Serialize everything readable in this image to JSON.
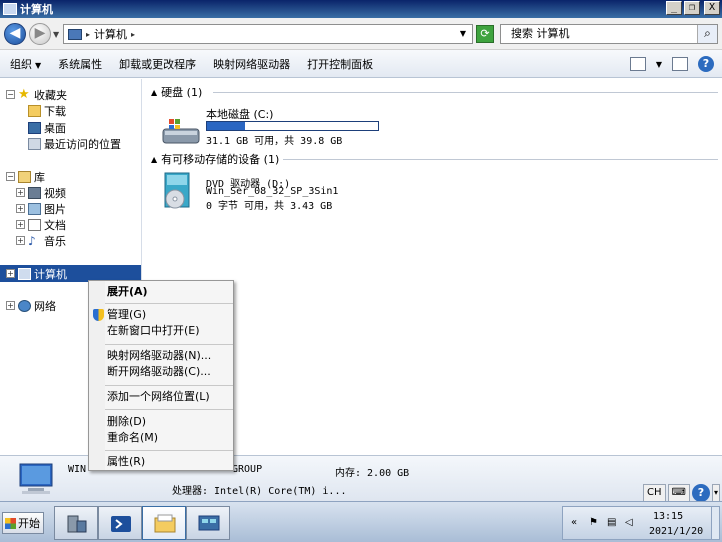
{
  "window": {
    "title": "计算机",
    "buttons": {
      "minimize": "_",
      "restore": "❐",
      "close": "X"
    }
  },
  "address": {
    "crumb": "计算机",
    "search_placeholder": "搜索 计算机"
  },
  "toolbar": {
    "items": [
      "组织",
      "系统属性",
      "卸载或更改程序",
      "映射网络驱动器",
      "打开控制面板"
    ],
    "help": "?"
  },
  "nav": {
    "favorites": "收藏夹",
    "downloads": "下载",
    "desktop": "桌面",
    "recent": "最近访问的位置",
    "libraries": "库",
    "videos": "视频",
    "pictures": "图片",
    "documents": "文档",
    "music": "音乐",
    "computer": "计算机",
    "network": "网络"
  },
  "content": {
    "hdd_group": "硬盘 (1)",
    "drive_c_name": "本地磁盘 (C:)",
    "drive_c_used_fraction": 0.22,
    "drive_c_size": "31.1 GB 可用，共 39.8 GB",
    "removable_group": "有可移动存储的设备 (1)",
    "dvd_name": "DVD 驱动器 (D:)",
    "dvd_label": "Win_Ser_08_32_SP_3Sin1",
    "dvd_size": "0 字节 可用，共 3.43 GB"
  },
  "details": {
    "name": "WIN",
    "workgroup": "GROUP",
    "memory": "内存: 2.00 GB",
    "cpu": "处理器: Intel(R) Core(TM) i..."
  },
  "lang": {
    "code": "CH",
    "help": "?"
  },
  "context_menu": {
    "expand": "展开(A)",
    "manage": "管理(G)",
    "open_new_window": "在新窗口中打开(E)",
    "map_drive": "映射网络驱动器(N)...",
    "disconnect_drive": "断开网络驱动器(C)...",
    "add_network_location": "添加一个网络位置(L)",
    "delete": "删除(D)",
    "rename": "重命名(M)",
    "properties": "属性(R)"
  },
  "taskbar": {
    "start": "开始",
    "clock_time": "13:15",
    "clock_date": "2021/1/20"
  }
}
